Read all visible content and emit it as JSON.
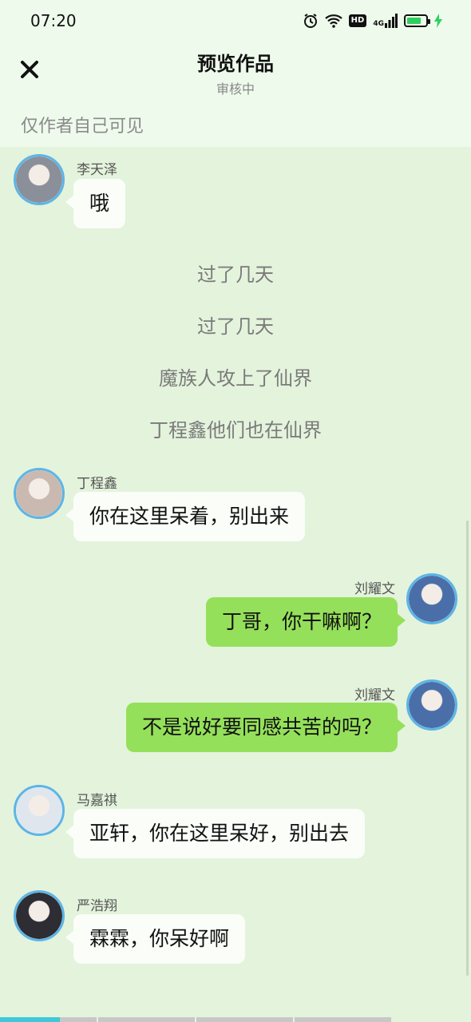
{
  "status_bar": {
    "time": "07:20",
    "hd_badge": "HD",
    "network": "4G",
    "battery_level": 0.75,
    "icons": [
      "alarm-icon",
      "wifi-icon",
      "hd-icon",
      "signal-icon",
      "battery-icon",
      "charging-icon"
    ]
  },
  "header": {
    "close_icon": "close-icon",
    "title": "预览作品",
    "subtitle": "审核中",
    "visibility_note": "仅作者自己可见"
  },
  "messages": [
    {
      "type": "message",
      "side": "left",
      "name": "李天泽",
      "text": "哦",
      "avatar_color": "#8a8f99"
    },
    {
      "type": "narration",
      "text": "过了几天"
    },
    {
      "type": "narration",
      "text": "过了几天"
    },
    {
      "type": "narration",
      "text": "魔族人攻上了仙界"
    },
    {
      "type": "narration",
      "text": "丁程鑫他们也在仙界"
    },
    {
      "type": "message",
      "side": "left",
      "name": "丁程鑫",
      "text": "你在这里呆着，别出来",
      "avatar_color": "#c9b9b0"
    },
    {
      "type": "message",
      "side": "right",
      "name": "刘耀文",
      "text": "丁哥，你干嘛啊？",
      "avatar_color": "#4a6fa8"
    },
    {
      "type": "message",
      "side": "right",
      "name": "刘耀文",
      "text": "不是说好要同感共苦的吗？",
      "avatar_color": "#4a6fa8"
    },
    {
      "type": "message",
      "side": "left",
      "name": "马嘉祺",
      "text": "亚轩，你在这里呆好，别出去",
      "avatar_color": "#dfe6ee"
    },
    {
      "type": "message",
      "side": "left",
      "name": "严浩翔",
      "text": "霖霖，你呆好啊",
      "avatar_color": "#2d2d33"
    }
  ],
  "progress": {
    "segments_total": 4,
    "current_segment": 1,
    "current_segment_fill": 0.62,
    "active_color": "#3fc8d8",
    "inactive_color": "#c7c7c7"
  },
  "colors": {
    "background": "#e4f3dc",
    "header_background": "#eefbec",
    "bubble_right": "#95e05a",
    "bubble_left": "#fafdf8",
    "avatar_border": "#5cb5e6"
  }
}
